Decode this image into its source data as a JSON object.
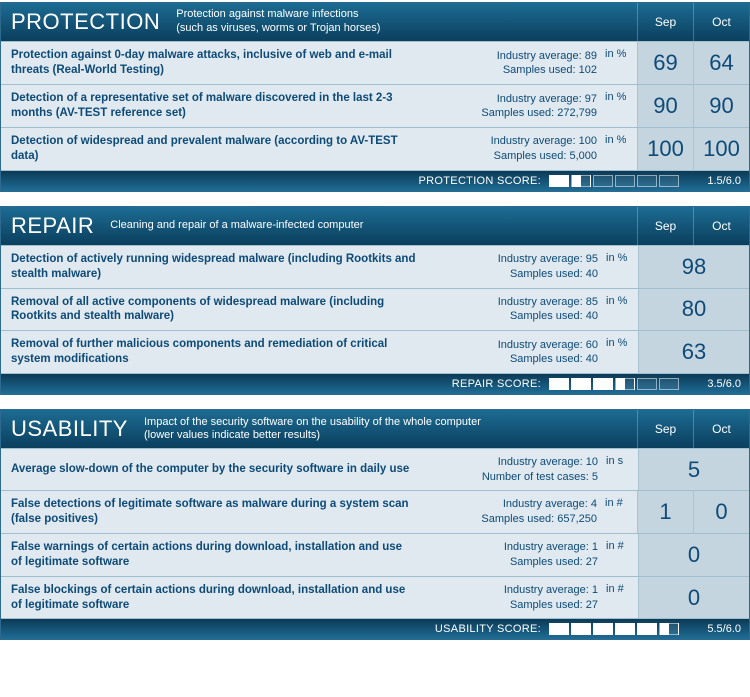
{
  "months": {
    "sep": "Sep",
    "oct": "Oct"
  },
  "sections": [
    {
      "id": "protection",
      "title": "PROTECTION",
      "subtitle_line1": "Protection against malware infections",
      "subtitle_line2": "(such as viruses, worms or Trojan horses)",
      "score_label": "PROTECTION SCORE:",
      "score_text": "1.5/6.0",
      "score_numeric": 1.5,
      "score_max": 6.0,
      "rows": [
        {
          "desc": "Protection against 0-day malware attacks, inclusive of web and e-mail threats (Real-World Testing)",
          "meta_line1": "Industry average: 89",
          "meta_line2": "Samples used: 102",
          "unit": "in %",
          "sep": "69",
          "oct": "64",
          "merged": false
        },
        {
          "desc": "Detection of a representative set of malware discovered in the last 2-3 months (AV-TEST reference set)",
          "meta_line1": "Industry average: 97",
          "meta_line2": "Samples used: 272,799",
          "unit": "in %",
          "sep": "90",
          "oct": "90",
          "merged": false
        },
        {
          "desc": "Detection of widespread and prevalent malware (according to AV-TEST data)",
          "meta_line1": "Industry average: 100",
          "meta_line2": "Samples used: 5,000",
          "unit": "in %",
          "sep": "100",
          "oct": "100",
          "merged": false
        }
      ]
    },
    {
      "id": "repair",
      "title": "REPAIR",
      "subtitle_line1": "Cleaning and repair of a malware-infected computer",
      "subtitle_line2": "",
      "score_label": "REPAIR SCORE:",
      "score_text": "3.5/6.0",
      "score_numeric": 3.5,
      "score_max": 6.0,
      "rows": [
        {
          "desc": "Detection of actively running widespread malware (including Rootkits and stealth malware)",
          "meta_line1": "Industry average: 95",
          "meta_line2": "Samples used: 40",
          "unit": "in %",
          "sep": "98",
          "oct": "",
          "merged": true
        },
        {
          "desc": "Removal of all active components of widespread malware (including Rootkits and stealth malware)",
          "meta_line1": "Industry average: 85",
          "meta_line2": "Samples used: 40",
          "unit": "in %",
          "sep": "80",
          "oct": "",
          "merged": true
        },
        {
          "desc": "Removal of further malicious components and remediation of critical system modifications",
          "meta_line1": "Industry average: 60",
          "meta_line2": "Samples used: 40",
          "unit": "in %",
          "sep": "63",
          "oct": "",
          "merged": true
        }
      ]
    },
    {
      "id": "usability",
      "title": "USABILITY",
      "subtitle_line1": "Impact of the security software on the usability of the whole computer",
      "subtitle_line2": "(lower values indicate better results)",
      "score_label": "USABILITY SCORE:",
      "score_text": "5.5/6.0",
      "score_numeric": 5.5,
      "score_max": 6.0,
      "rows": [
        {
          "desc": "Average slow-down of the computer by the security software in daily use",
          "meta_line1": "Industry average: 10",
          "meta_line2": "Number of test cases: 5",
          "unit": "in s",
          "sep": "5",
          "oct": "",
          "merged": true
        },
        {
          "desc": "False detections of legitimate software as malware during a system scan (false positives)",
          "meta_line1": "Industry average: 4",
          "meta_line2": "Samples used: 657,250",
          "unit": "in #",
          "sep": "1",
          "oct": "0",
          "merged": false
        },
        {
          "desc": "False warnings of certain actions during download, installation and use of legitimate software",
          "meta_line1": "Industry average: 1",
          "meta_line2": "Samples used: 27",
          "unit": "in #",
          "sep": "0",
          "oct": "",
          "merged": true
        },
        {
          "desc": "False blockings of certain actions during download, installation and use of legitimate software",
          "meta_line1": "Industry average: 1",
          "meta_line2": "Samples used: 27",
          "unit": "in #",
          "sep": "0",
          "oct": "",
          "merged": true
        }
      ]
    }
  ]
}
